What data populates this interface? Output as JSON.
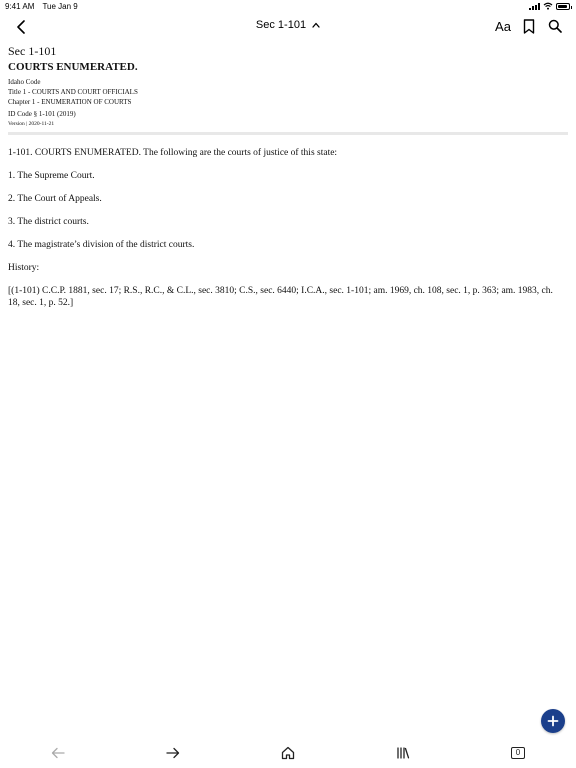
{
  "status_bar": {
    "time": "9:41 AM",
    "date": "Tue Jan 9"
  },
  "nav": {
    "title": "Sec 1-101",
    "text_size_label": "Aa",
    "icons": {
      "back": "chevron-left-icon",
      "title_toggle": "chevron-up-icon",
      "bookmark": "bookmark-icon",
      "search": "search-icon"
    }
  },
  "document": {
    "section_number": "Sec 1-101",
    "section_title": "COURTS ENUMERATED.",
    "code_name": "Idaho Code",
    "title_line": "Title 1 - COURTS AND COURT OFFICIALS",
    "chapter_line": "Chapter 1 - ENUMERATION OF COURTS",
    "id_code": "ID Code § 1-101 (2019)",
    "version": "Version | 2020-11-21",
    "paragraphs": [
      "1-101. COURTS ENUMERATED. The following are the courts of justice of this state:",
      "1. The Supreme Court.",
      "2. The Court of Appeals.",
      "3. The district courts.",
      "4. The magistrate’s division of the district courts.",
      "History:",
      "[(1-101) C.C.P. 1881, sec. 17; R.S., R.C., & C.L., sec. 3810; C.S., sec. 6440; I.C.A., sec. 1-101; am. 1969, ch. 108, sec. 1, p. 363; am. 1983, ch. 18, sec. 1, p. 52.]"
    ]
  },
  "fab": {
    "icon": "plus-icon",
    "color": "#1b3f8b"
  },
  "toolbar": {
    "icons": [
      "arrow-left-icon",
      "arrow-right-icon",
      "home-icon",
      "library-icon",
      "tabs-icon"
    ],
    "tabs_count": "0"
  }
}
